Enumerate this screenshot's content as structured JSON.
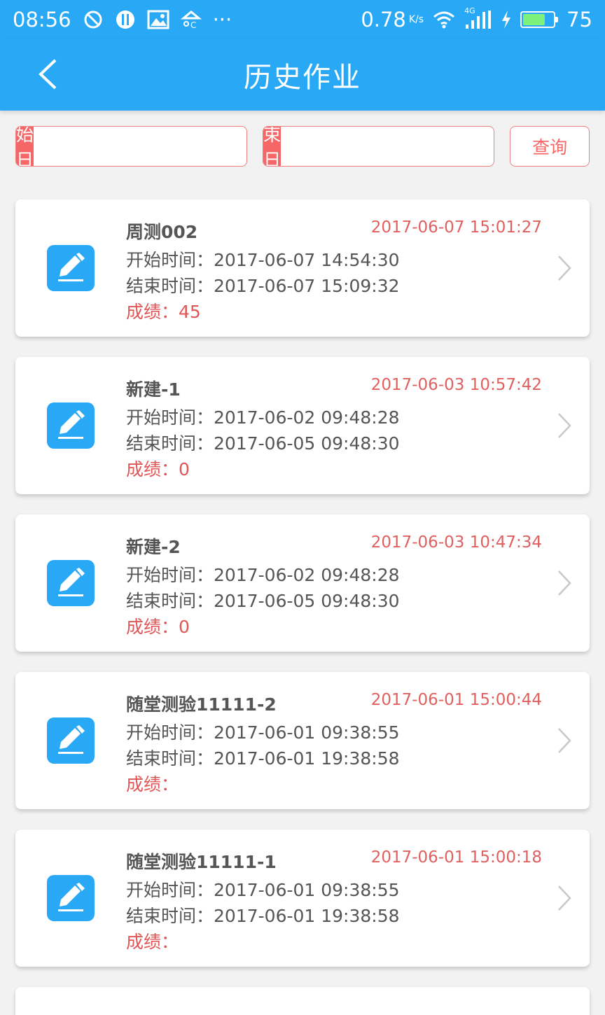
{
  "status_bar": {
    "time": "08:56",
    "more": "···",
    "net_speed": "0.78",
    "net_unit": "K/s",
    "network_type": "4G",
    "battery": "75",
    "battery_level": 0.75,
    "icons": [
      "blocked-icon",
      "utensils-icon",
      "image-icon",
      "weather-icon",
      "wifi-icon",
      "signal-icon",
      "charging-icon",
      "battery-icon"
    ]
  },
  "header": {
    "title": "历史作业",
    "back_icon": "chevron-left-icon"
  },
  "filter": {
    "start_label": "开始日期",
    "start_value": "",
    "end_label": "结束日期",
    "end_value": "",
    "query_label": "查询",
    "calendar_icon": "calendar-icon"
  },
  "colors": {
    "primary": "#29a9f5",
    "accent": "#f56767",
    "text": "#555555",
    "date_red": "#e06060"
  },
  "list": {
    "start_prefix": "开始时间：",
    "end_prefix": "结束时间：",
    "score_prefix": "成绩：",
    "item_icon": "edit-pen-icon",
    "items": [
      {
        "title": "周测002",
        "submitted": "2017-06-07 15:01:27",
        "start": "2017-06-07 14:54:30",
        "end": "2017-06-07 15:09:32",
        "score": "45"
      },
      {
        "title": "新建-1",
        "submitted": "2017-06-03 10:57:42",
        "start": "2017-06-02 09:48:28",
        "end": "2017-06-05 09:48:30",
        "score": "0"
      },
      {
        "title": "新建-2",
        "submitted": "2017-06-03 10:47:34",
        "start": "2017-06-02 09:48:28",
        "end": "2017-06-05 09:48:30",
        "score": "0"
      },
      {
        "title": "随堂测验11111-2",
        "submitted": "2017-06-01 15:00:44",
        "start": "2017-06-01 09:38:55",
        "end": "2017-06-01 19:38:58",
        "score": ""
      },
      {
        "title": "随堂测验11111-1",
        "submitted": "2017-06-01 15:00:18",
        "start": "2017-06-01 09:38:55",
        "end": "2017-06-01 19:38:58",
        "score": ""
      }
    ]
  }
}
